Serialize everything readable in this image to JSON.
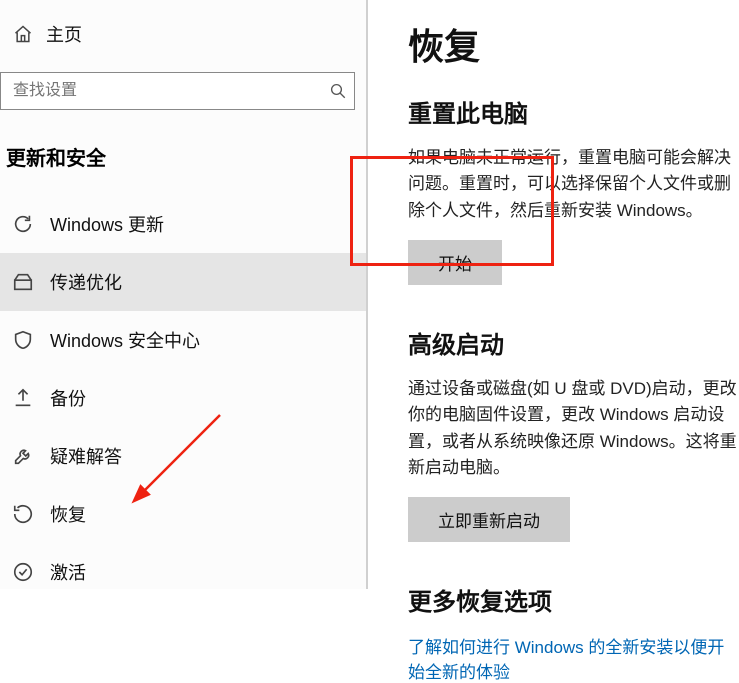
{
  "sidebar": {
    "home_label": "主页",
    "search_placeholder": "查找设置",
    "section": "更新和安全",
    "items": [
      {
        "label": "Windows 更新"
      },
      {
        "label": "传递优化"
      },
      {
        "label": "Windows 安全中心"
      },
      {
        "label": "备份"
      },
      {
        "label": "疑难解答"
      },
      {
        "label": "恢复"
      },
      {
        "label": "激活"
      }
    ]
  },
  "main": {
    "title": "恢复",
    "reset": {
      "heading": "重置此电脑",
      "body": "如果电脑未正常运行，重置电脑可能会解决问题。重置时，可以选择保留个人文件或删除个人文件，然后重新安装 Windows。",
      "button": "开始"
    },
    "advanced": {
      "heading": "高级启动",
      "body": "通过设备或磁盘(如 U 盘或 DVD)启动，更改你的电脑固件设置，更改 Windows 启动设置，或者从系统映像还原 Windows。这将重新启动电脑。",
      "button": "立即重新启动"
    },
    "more": {
      "heading": "更多恢复选项",
      "link": "了解如何进行 Windows 的全新安装以便开始全新的体验"
    }
  }
}
